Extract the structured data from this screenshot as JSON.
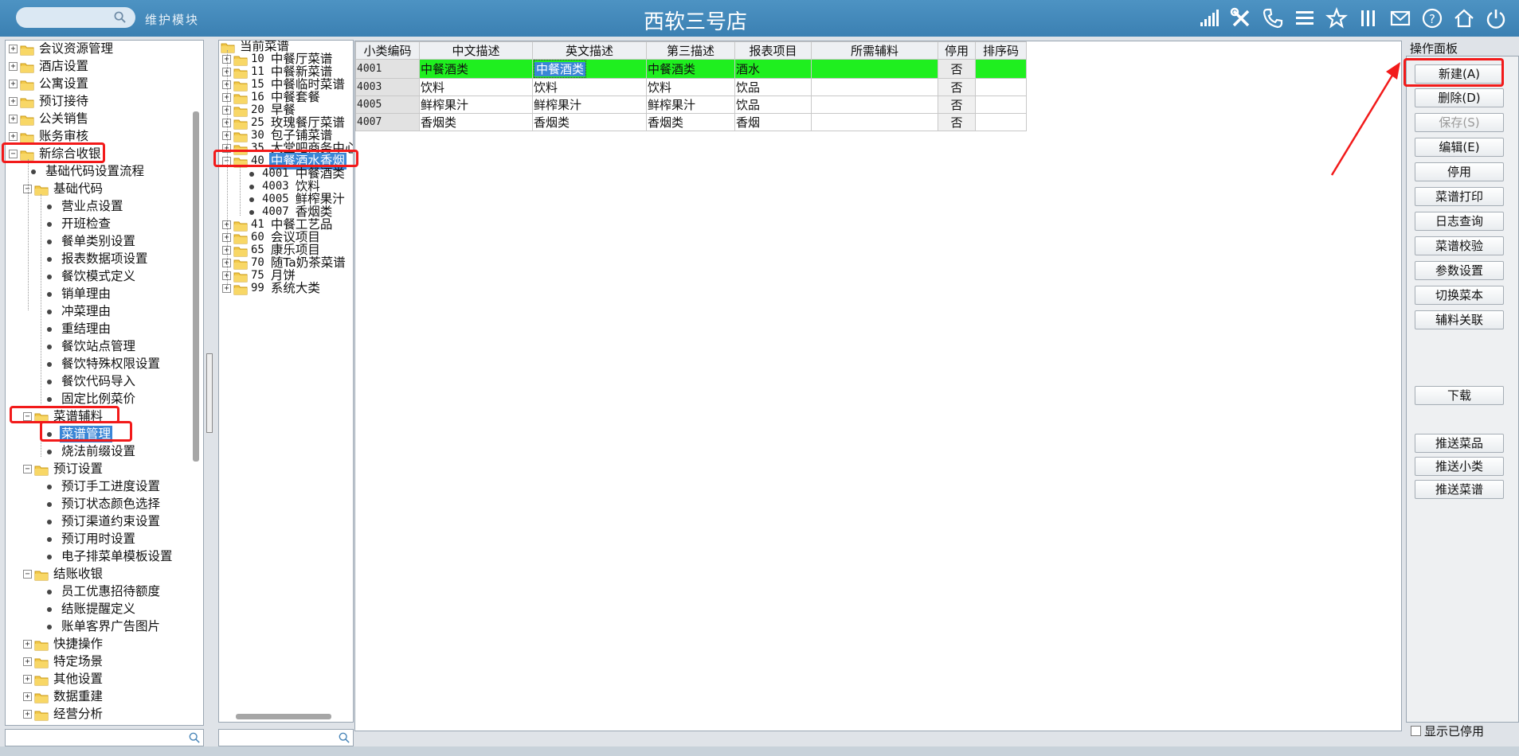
{
  "header": {
    "module_label": "维护模块",
    "store_title": "西软三号店",
    "icons": [
      "signal-icon",
      "tools-icon",
      "phone-icon",
      "menu-icon",
      "star-icon",
      "columns-icon",
      "mail-icon",
      "help-icon",
      "home-icon",
      "power-icon"
    ]
  },
  "left_tree": {
    "top_items": [
      "会议资源管理",
      "酒店设置",
      "公寓设置",
      "预订接待",
      "公关销售",
      "账务审核"
    ],
    "new_cashier": "新综合收银",
    "basic_flow": "基础代码设置流程",
    "basic_code": "基础代码",
    "basic_children": [
      "营业点设置",
      "开班检查",
      "餐单类别设置",
      "报表数据项设置",
      "餐饮模式定义",
      "销单理由",
      "冲菜理由",
      "重结理由",
      "餐饮站点管理",
      "餐饮特殊权限设置",
      "餐饮代码导入",
      "固定比例菜价"
    ],
    "menu_aux": "菜谱辅料",
    "menu_manage": "菜谱管理",
    "cook_method": "烧法前缀设置",
    "booking_settings": "预订设置",
    "booking_children": [
      "预订手工进度设置",
      "预订状态颜色选择",
      "预订渠道约束设置",
      "预订用时设置",
      "电子排菜单模板设置"
    ],
    "checkout": "结账收银",
    "checkout_children": [
      "员工优惠招待额度",
      "结账提醒定义",
      "账单客界广告图片"
    ],
    "bottom_items": [
      "快捷操作",
      "特定场景",
      "其他设置",
      "数据重建",
      "经营分析"
    ]
  },
  "middle_tree": {
    "root": "当前菜谱",
    "categories": [
      {
        "code": "10",
        "name": "中餐厅菜谱"
      },
      {
        "code": "11",
        "name": "中餐新菜谱"
      },
      {
        "code": "15",
        "name": "中餐临时菜谱"
      },
      {
        "code": "16",
        "name": "中餐套餐"
      },
      {
        "code": "20",
        "name": "早餐"
      },
      {
        "code": "25",
        "name": "玫瑰餐厅菜谱"
      },
      {
        "code": "30",
        "name": "包子铺菜谱"
      },
      {
        "code": "35",
        "name": "大堂吧商务中心"
      }
    ],
    "selected": {
      "code": "40",
      "name": "中餐酒水香烟"
    },
    "selected_children": [
      {
        "code": "4001",
        "name": "中餐酒类"
      },
      {
        "code": "4003",
        "name": "饮料"
      },
      {
        "code": "4005",
        "name": "鲜榨果汁"
      },
      {
        "code": "4007",
        "name": "香烟类"
      }
    ],
    "after": [
      {
        "code": "41",
        "name": "中餐工艺品"
      },
      {
        "code": "60",
        "name": "会议项目"
      },
      {
        "code": "65",
        "name": "康乐项目"
      },
      {
        "code": "70",
        "name": "随Ta奶茶菜谱"
      },
      {
        "code": "75",
        "name": "月饼"
      },
      {
        "code": "99",
        "name": "系统大类"
      }
    ]
  },
  "grid": {
    "columns": [
      "小类编码",
      "中文描述",
      "英文描述",
      "第三描述",
      "报表项目",
      "所需辅料",
      "停用",
      "排序码"
    ],
    "rows": [
      [
        "4001",
        "中餐酒类",
        "中餐酒类",
        "中餐酒类",
        "酒水",
        "",
        "否",
        ""
      ],
      [
        "4003",
        "饮料",
        "饮料",
        "饮料",
        "饮品",
        "",
        "否",
        ""
      ],
      [
        "4005",
        "鲜榨果汁",
        "鲜榨果汁",
        "鲜榨果汁",
        "饮品",
        "",
        "否",
        ""
      ],
      [
        "4007",
        "香烟类",
        "香烟类",
        "香烟类",
        "香烟",
        "",
        "否",
        ""
      ]
    ]
  },
  "ops": {
    "title": "操作面板",
    "new": "新建(A)",
    "delete": "删除(D)",
    "save": "保存(S)",
    "edit": "编辑(E)",
    "disable": "停用",
    "print_menu": "菜谱打印",
    "log_query": "日志查询",
    "menu_check": "菜谱校验",
    "param_setting": "参数设置",
    "switch_menu": "切换菜本",
    "aux_link": "辅料关联",
    "download": "下载",
    "push_dish": "推送菜品",
    "push_subclass": "推送小类",
    "push_menu": "推送菜谱",
    "show_disabled": "显示已停用"
  },
  "colors": {
    "header": "#3b80b2",
    "active_row": "#1fef1f",
    "selection": "#3a86d6",
    "annotation": "#f21a1a",
    "folder": "#f3c94a"
  }
}
